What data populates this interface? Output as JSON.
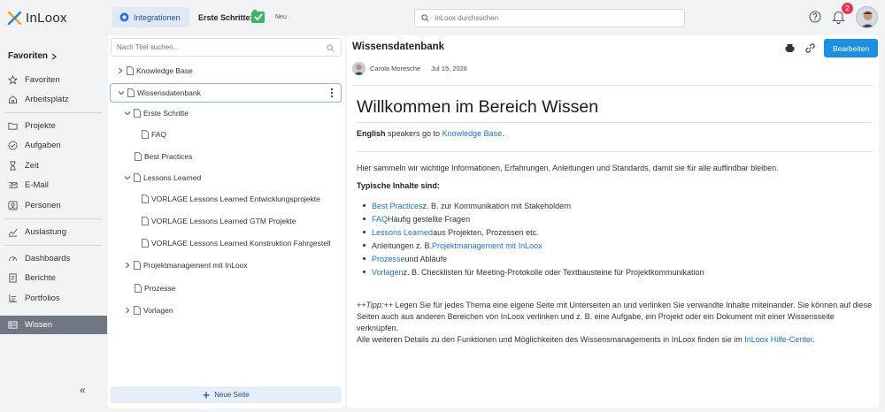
{
  "app": {
    "name": "InLoox",
    "integrations_label": "Integrationen",
    "first_steps_label": "Erste Schritte:",
    "new_label": "Neu",
    "search_placeholder": "InLoox durchsuchen",
    "notification_count": "2",
    "colors": {
      "accent": "#1e8fe0",
      "active_nav": "#6f7882",
      "link": "#1f6fc5",
      "badge": "#e53950"
    }
  },
  "nav": {
    "favorites_header": "Favoriten",
    "items": [
      {
        "label": "Favoriten",
        "icon": "star-icon"
      },
      {
        "label": "Arbeitsplatz",
        "icon": "home-icon"
      },
      {
        "label": "Projekte",
        "icon": "folder-icon"
      },
      {
        "label": "Aufgaben",
        "icon": "check-circle-icon"
      },
      {
        "label": "Zeit",
        "icon": "hourglass-icon"
      },
      {
        "label": "E-Mail",
        "icon": "mail-icon"
      },
      {
        "label": "Personen",
        "icon": "person-icon"
      },
      {
        "label": "Auslastung",
        "icon": "gauge-icon"
      },
      {
        "label": "Dashboards",
        "icon": "dashboard-icon"
      },
      {
        "label": "Berichte",
        "icon": "report-icon"
      },
      {
        "label": "Portfolios",
        "icon": "portfolio-icon"
      },
      {
        "label": "Wissen",
        "icon": "book-icon"
      }
    ],
    "collapse_glyph": "«"
  },
  "tree": {
    "search_placeholder": "Nach Titel suchen...",
    "nodes": [
      {
        "label": "Knowledge Base"
      },
      {
        "label": "Wissensdatenbank"
      },
      {
        "label": "Erste Schritte"
      },
      {
        "label": "FAQ"
      },
      {
        "label": "Best Practices"
      },
      {
        "label": "Lessons Learned"
      },
      {
        "label": "VORLAGE Lessons Learned Entwicklungsprojekte"
      },
      {
        "label": "VORLAGE Lessons Learned GTM Projekte"
      },
      {
        "label": "VORLAGE Lessons Learned Konstruktion Fahrgestell"
      },
      {
        "label": "Projektmanagement mit InLoox"
      },
      {
        "label": "Prozesse"
      },
      {
        "label": "Vorlagen"
      }
    ],
    "new_page_label": "Neue Seite"
  },
  "content": {
    "title": "Wissensdatenbank",
    "edit_label": "Bearbeiten",
    "author": "Carola Moresche",
    "date": "Jul 15, 2026",
    "heading": "Willkommen im Bereich Wissen",
    "english_bold": "English",
    "english_mid": " speakers go to ",
    "english_link": "Knowledge Base",
    "english_end": ".",
    "intro": "Hier sammeln wir wichtige Informationen, Erfahrungen, Anleitungen und Standards, damit sie für alle auffindbar bleiben.",
    "typical_heading": "Typische Inhalte sind:",
    "bullets": [
      {
        "link": "Best Practices",
        "pre": "",
        "text": " z. B. zur Kommunikation mit Stakeholdern"
      },
      {
        "link": "FAQ",
        "pre": "",
        "text": " Häufig gestellte Fragen"
      },
      {
        "link": "Lessons Learned",
        "pre": "",
        "text": " aus Projekten, Prozessen etc."
      },
      {
        "link": "Projektmanagement mit InLoox",
        "pre": "Anleitungen z. B. ",
        "text": ""
      },
      {
        "link": "Prozesse",
        "pre": "",
        "text": " und Abläufe"
      },
      {
        "link": "Vorlagen",
        "pre": "",
        "text": " z. B. Checklisten für Meeting-Protokolle oder Textbausteine für Projektkommunikation"
      }
    ],
    "tip_label": "++Tipp:++",
    "tip_text": " Legen Sie für jedes Thema eine eigene Seite mit Unterseiten an und verlinken Sie verwandte Inhalte miteinander. Sie können auf diese Seiten auch aus anderen Bereichen von InLoox verlinken und z. B. eine Aufgabe, ein Projekt oder ein Dokument mit einer Wissensseite verknüpfen.",
    "details_text": "Alle weiteren Details zu den Funktionen und Möglichkeiten des Wissensmanagements in InLoox finden sie im ",
    "details_link": "InLoox Hilfe-Center",
    "details_end": "."
  }
}
